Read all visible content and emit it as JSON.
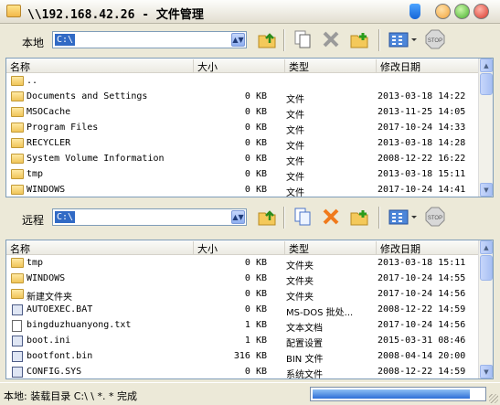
{
  "window": {
    "title": "\\\\192.168.42.26 - 文件管理"
  },
  "local": {
    "label": "本地",
    "path": "C:\\",
    "columns": [
      "名称",
      "大小",
      "类型",
      "修改日期"
    ],
    "rows": [
      {
        "name": "..",
        "size": "",
        "type": "",
        "date": "",
        "icon": "folder-icon"
      },
      {
        "name": "Documents and Settings",
        "size": "0 KB",
        "type": "文件",
        "date": "2013-03-18 14:22",
        "icon": "folder-icon"
      },
      {
        "name": "MSOCache",
        "size": "0 KB",
        "type": "文件",
        "date": "2013-11-25 14:05",
        "icon": "folder-icon"
      },
      {
        "name": "Program Files",
        "size": "0 KB",
        "type": "文件",
        "date": "2017-10-24 14:33",
        "icon": "folder-icon"
      },
      {
        "name": "RECYCLER",
        "size": "0 KB",
        "type": "文件",
        "date": "2013-03-18 14:28",
        "icon": "folder-icon"
      },
      {
        "name": "System Volume Information",
        "size": "0 KB",
        "type": "文件",
        "date": "2008-12-22 16:22",
        "icon": "folder-icon"
      },
      {
        "name": "tmp",
        "size": "0 KB",
        "type": "文件",
        "date": "2013-03-18 15:11",
        "icon": "folder-icon"
      },
      {
        "name": "WINDOWS",
        "size": "0 KB",
        "type": "文件",
        "date": "2017-10-24 14:41",
        "icon": "folder-icon"
      }
    ]
  },
  "remote": {
    "label": "远程",
    "path": "C:\\",
    "columns": [
      "名称",
      "大小",
      "类型",
      "修改日期"
    ],
    "rows": [
      {
        "name": "tmp",
        "size": "0 KB",
        "type": "文件夹",
        "date": "2013-03-18 15:11",
        "icon": "folder-icon"
      },
      {
        "name": "WINDOWS",
        "size": "0 KB",
        "type": "文件夹",
        "date": "2017-10-24 14:55",
        "icon": "folder-icon"
      },
      {
        "name": "新建文件夹",
        "size": "0 KB",
        "type": "文件夹",
        "date": "2017-10-24 14:56",
        "icon": "folder-icon"
      },
      {
        "name": "AUTOEXEC.BAT",
        "size": "0 KB",
        "type": "MS-DOS 批处...",
        "date": "2008-12-22 14:59",
        "icon": "batch-file-icon"
      },
      {
        "name": "bingduzhuanyong.txt",
        "size": "1 KB",
        "type": "文本文档",
        "date": "2017-10-24 14:56",
        "icon": "text-file-icon"
      },
      {
        "name": "boot.ini",
        "size": "1 KB",
        "type": "配置设置",
        "date": "2015-03-31 08:46",
        "icon": "config-file-icon"
      },
      {
        "name": "bootfont.bin",
        "size": "316 KB",
        "type": "BIN 文件",
        "date": "2008-04-14 20:00",
        "icon": "system-file-icon"
      },
      {
        "name": "CONFIG.SYS",
        "size": "0 KB",
        "type": "系统文件",
        "date": "2008-12-22 14:59",
        "icon": "system-file-icon"
      }
    ]
  },
  "toolbar": {
    "buttons": [
      "up-folder-icon",
      "copy-icon",
      "delete-icon",
      "new-folder-icon",
      "view-icon",
      "stop-icon"
    ],
    "stop_label": "STOP"
  },
  "status": {
    "text": "本地: 装载目录 C:\\ \\ *. * 完成",
    "progress": 0.92
  },
  "colors": {
    "selection": "#316ac5",
    "progress": "#2e6fd6"
  }
}
